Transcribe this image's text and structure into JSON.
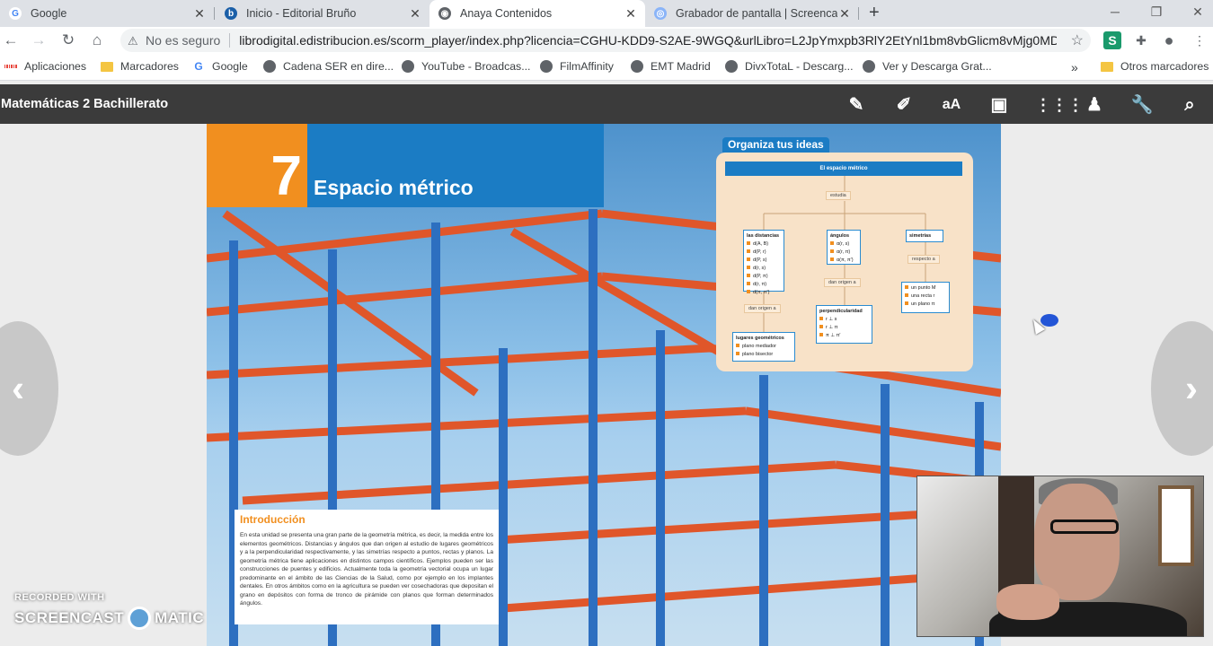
{
  "tabs": [
    {
      "title": "Google",
      "favicon": "google-g"
    },
    {
      "title": "Inicio - Editorial Bruño",
      "favicon": "bruno-logo"
    },
    {
      "title": "Anaya Contenidos",
      "favicon": "globe-icon",
      "active": true
    },
    {
      "title": "Grabador de pantalla | Screencas",
      "favicon": "screencast-icon"
    }
  ],
  "omnibox": {
    "security": "No es seguro",
    "url": "librodigital.edistribucion.es/scorm_player/index.php?licencia=CGHU-KDD9-S2AE-9WGQ&urlLibro=L2JpYmxpb3RlY2EtYnl1bm8vbGlicm8vMjg0MD..."
  },
  "bookmarks": {
    "apps": "Aplicaciones",
    "items": [
      "Marcadores",
      "Google",
      "Cadena SER en dire...",
      "YouTube - Broadcas...",
      "FilmAffinity",
      "EMT Madrid",
      "DivxTotaL - Descarg...",
      "Ver y Descarga Grat..."
    ],
    "overflow": "»",
    "other": "Otros marcadores"
  },
  "app": {
    "title": "Matemáticas 2 Bachillerato"
  },
  "book": {
    "unit_number": "7",
    "unit_title": "Espacio métrico",
    "organiza_title": "Organiza tus ideas",
    "map_title": "El espacio métrico",
    "map": {
      "estudia": "estudia",
      "distancias_title": "las distancias",
      "distancias": [
        "d(A, B)",
        "d(P, r)",
        "d(P, s)",
        "d(r, s)",
        "d(P, π)",
        "d(r, π)",
        "d(π, π')"
      ],
      "angulos_title": "ángulos",
      "angulos": [
        "α(r, s)",
        "α(r, π)",
        "α(π, π')"
      ],
      "simetrias_title": "simetrías",
      "respecto": "respecto a",
      "simetrias": [
        "un punto M",
        "una recta r",
        "un plano π"
      ],
      "dan_origen_1": "dan origen a",
      "dan_origen_2": "dan origen a",
      "perp_title": "perpendicularidad",
      "perp": [
        "r ⊥ s",
        "r ⊥ π",
        "π ⊥ π'"
      ],
      "lugares_title": "lugares geométricos",
      "lugares": [
        "plano mediador",
        "plano bisector"
      ]
    },
    "intro_title": "Introducción",
    "intro_text": "En esta unidad se presenta una gran parte de la geometría métrica, es decir, la medida entre los elementos geométricos. Distancias y ángulos que dan origen al estudio de lugares geométricos y a la perpendicularidad respectivamente, y las simetrías respecto a puntos, rectas y planos. La geometría métrica tiene aplicaciones en distintos campos científicos. Ejemplos pueden ser las construcciones de puentes y edificios. Actualmente toda la geometría vectorial ocupa un lugar predominante en el ámbito de las Ciencias de la Salud, como por ejemplo en los implantes dentales. En otros ámbitos como en la agricultura se pueden ver cosechadoras que depositan el grano en depósitos con forma de tronco de pirámide con planos que forman determinados ángulos."
  },
  "watermark": {
    "line1": "RECORDED WITH",
    "line2a": "SCREENCAST",
    "line2b": "MATIC"
  },
  "colors": {
    "orange": "#f18f1f",
    "blue": "#1b7cc4",
    "header": "#3b3b3b"
  }
}
